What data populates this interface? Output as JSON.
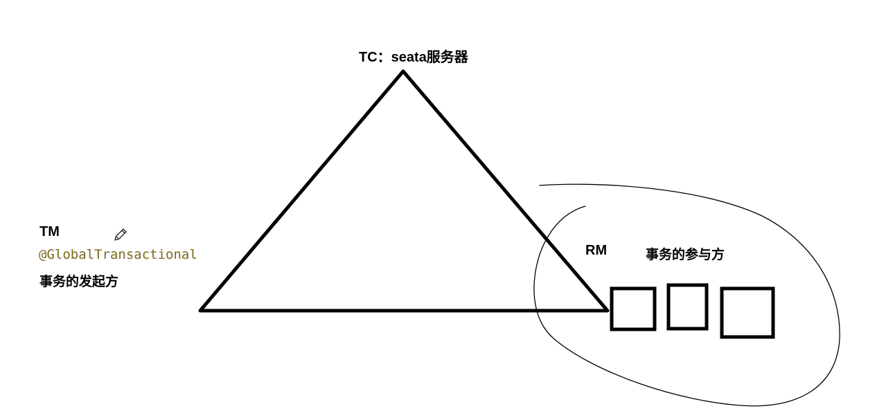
{
  "nodes": {
    "tc": {
      "label": "TC：seata服务器"
    },
    "tm": {
      "label": "TM",
      "annotation": "@GlobalTransactional",
      "description": "事务的发起方"
    },
    "rm": {
      "label": "RM",
      "description": "事务的参与方",
      "resource_count": 3
    }
  },
  "icons": {
    "edit": "pencil-icon"
  },
  "colors": {
    "stroke": "#000000",
    "annotation": "#7a6a1a",
    "background": "#ffffff"
  }
}
